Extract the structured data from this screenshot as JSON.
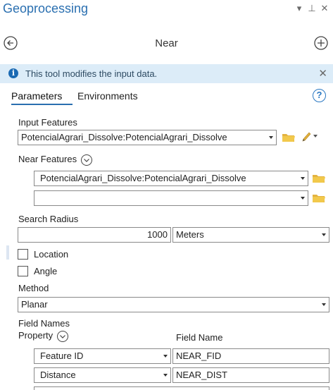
{
  "pane": {
    "title": "Geoprocessing",
    "controls": {
      "pin": "▾",
      "auto_hide": "⊥",
      "close": "✕"
    }
  },
  "header": {
    "tool_name": "Near"
  },
  "info_bar": {
    "icon": "i",
    "message": "This tool modifies the input data.",
    "close": "✕"
  },
  "tabs": {
    "parameters": "Parameters",
    "environments": "Environments",
    "help": "?"
  },
  "params": {
    "input_features": {
      "label": "Input Features",
      "value": "PotencialAgrari_Dissolve:PotencialAgrari_Dissolve"
    },
    "near_features": {
      "label": "Near Features",
      "rows": [
        {
          "value": "PotencialAgrari_Dissolve:PotencialAgrari_Dissolve"
        },
        {
          "value": ""
        }
      ]
    },
    "search_radius": {
      "label": "Search Radius",
      "value": "1000",
      "unit": "Meters"
    },
    "location": {
      "label": "Location",
      "checked": false
    },
    "angle": {
      "label": "Angle",
      "checked": false
    },
    "method": {
      "label": "Method",
      "value": "Planar"
    },
    "field_names": {
      "label": "Field Names",
      "property_header": "Property",
      "field_name_header": "Field Name",
      "rows": [
        {
          "property": "Feature ID",
          "field_name": "NEAR_FID"
        },
        {
          "property": "Distance",
          "field_name": "NEAR_DIST"
        }
      ]
    }
  },
  "colors": {
    "accent": "#2a6fb0",
    "info_bg": "#dcecf8",
    "folder": "#e3b341"
  }
}
